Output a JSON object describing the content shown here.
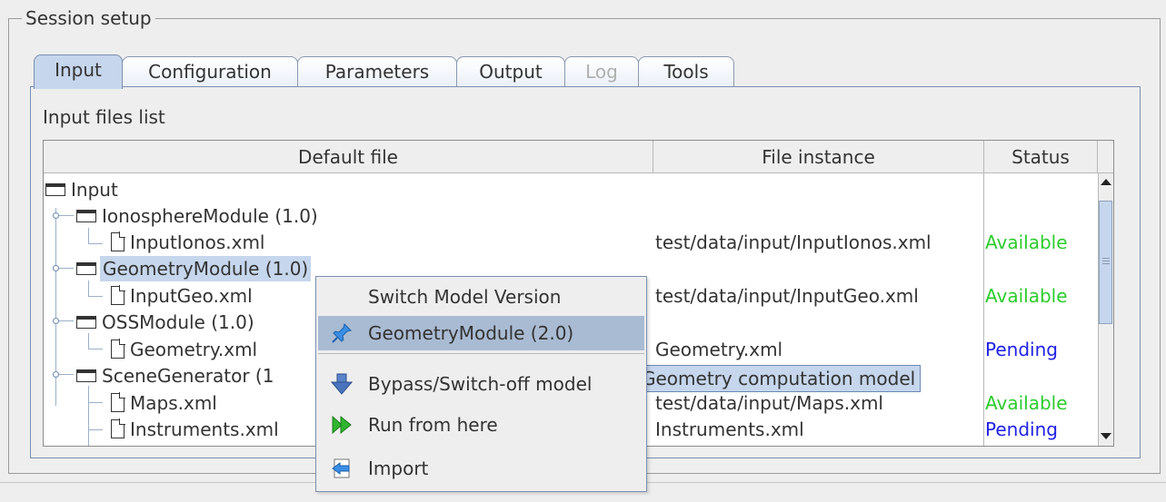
{
  "session": {
    "title": "Session setup"
  },
  "tabs": [
    {
      "label": "Input",
      "state": "selected"
    },
    {
      "label": "Configuration",
      "state": "normal"
    },
    {
      "label": "Parameters",
      "state": "normal"
    },
    {
      "label": "Output",
      "state": "normal"
    },
    {
      "label": "Log",
      "state": "disabled"
    },
    {
      "label": "Tools",
      "state": "normal"
    }
  ],
  "panel": {
    "title": "Input files list"
  },
  "table": {
    "columns": [
      "Default file",
      "File instance",
      "Status"
    ],
    "rows": [
      {
        "name": "Input",
        "type": "folder",
        "instance": "",
        "status": ""
      },
      {
        "name": "IonosphereModule (1.0)",
        "type": "folder",
        "instance": "",
        "status": ""
      },
      {
        "name": "InputIonos.xml",
        "type": "file",
        "instance": "test/data/input/InputIonos.xml",
        "status": "Available"
      },
      {
        "name": "GeometryModule (1.0)",
        "type": "folder",
        "instance": "",
        "status": "",
        "selected": true
      },
      {
        "name": "InputGeo.xml",
        "type": "file",
        "instance": "test/data/input/InputGeo.xml",
        "status": "Available"
      },
      {
        "name": "OSSModule (1.0)",
        "type": "folder",
        "instance": "",
        "status": ""
      },
      {
        "name": "Geometry.xml",
        "type": "file",
        "instance": "Geometry.xml",
        "status": "Pending"
      },
      {
        "name": "SceneGenerator (1",
        "type": "folder",
        "instance": "",
        "status": ""
      },
      {
        "name": "Maps.xml",
        "type": "file",
        "instance": "test/data/input/Maps.xml",
        "status": "Available"
      },
      {
        "name": "Instruments.xml",
        "type": "file",
        "instance": "Instruments.xml",
        "status": "Pending"
      }
    ]
  },
  "context_menu": {
    "header": "Switch Model Version",
    "items": [
      {
        "label": "GeometryModule (2.0)",
        "icon": "pin-icon",
        "highlighted": true
      },
      {
        "label": "Bypass/Switch-off model",
        "icon": "down-arrow-icon"
      },
      {
        "label": "Run from here",
        "icon": "fast-forward-icon"
      },
      {
        "label": "Import",
        "icon": "import-icon"
      }
    ]
  },
  "tooltip": {
    "text": "Geometry computation model"
  },
  "colors": {
    "selection": "#c6d6ec",
    "menu_highlight": "#a9bbd2",
    "available": "#2ccc2c",
    "pending": "#1f1fe8",
    "tab_border": "#7a8fb0"
  }
}
